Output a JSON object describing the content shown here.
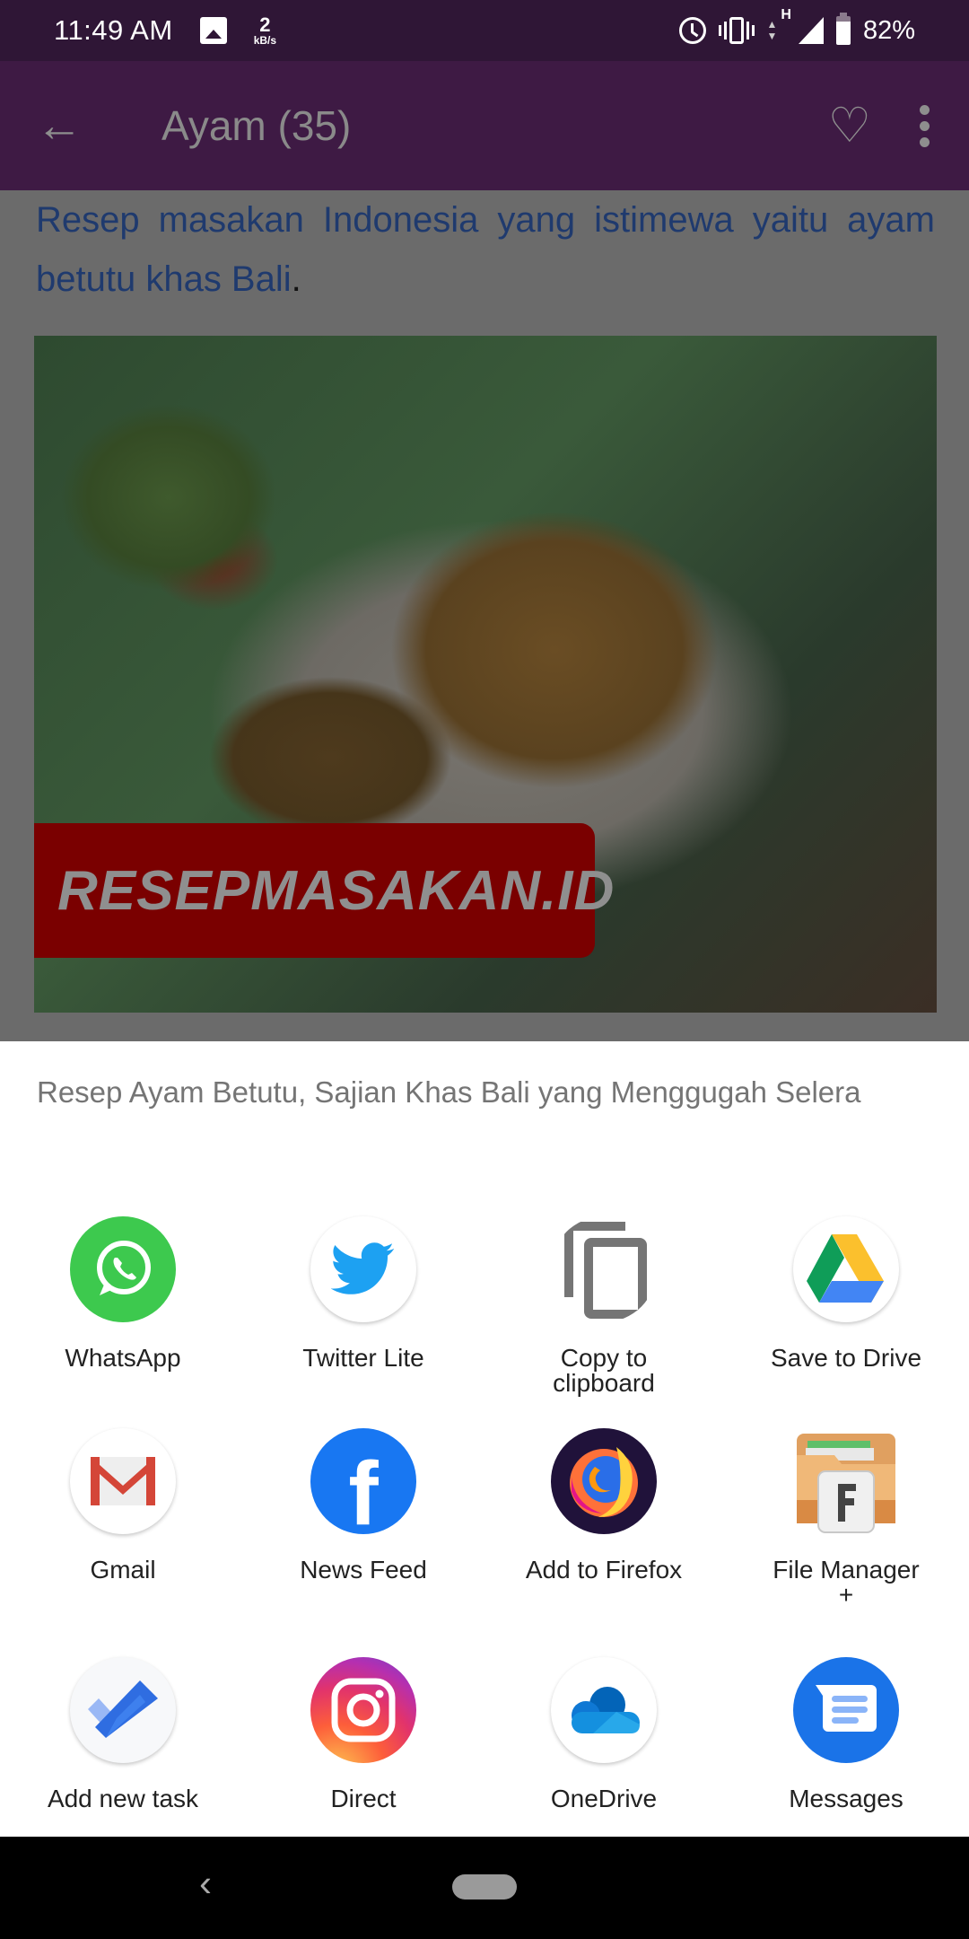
{
  "status_bar": {
    "time": "11:49 AM",
    "net_speed_value": "2",
    "net_speed_unit": "kB/s",
    "network_type": "H",
    "battery": "82%",
    "icons": [
      "gallery-icon",
      "alarm-icon",
      "vibrate-icon",
      "data-arrows-icon",
      "signal-icon",
      "battery-icon"
    ]
  },
  "app_bar": {
    "title": "Ayam (35)",
    "back_icon": "←",
    "favorite_icon": "♡"
  },
  "content": {
    "intro_text": "Resep masakan Indonesia yang istimewa yaitu ayam betutu khas Bali",
    "intro_end": ".",
    "image_watermark": "RESEPMASAKAN.ID"
  },
  "share_sheet": {
    "title": "Resep Ayam Betutu, Sajian Khas Bali yang Menggugah Selera",
    "apps": [
      {
        "label": "WhatsApp",
        "icon": "whatsapp-icon"
      },
      {
        "label": "Twitter Lite",
        "icon": "twitter-icon"
      },
      {
        "label": "Copy to clipboard",
        "icon": "copy-icon"
      },
      {
        "label": "Save to Drive",
        "icon": "google-drive-icon"
      },
      {
        "label": "Gmail",
        "icon": "gmail-icon"
      },
      {
        "label": "News Feed",
        "icon": "facebook-icon"
      },
      {
        "label": "Add to Firefox",
        "icon": "firefox-icon"
      },
      {
        "label": "File Manager +",
        "icon": "file-manager-icon"
      },
      {
        "label": "Add new task",
        "icon": "todo-icon"
      },
      {
        "label": "Direct",
        "icon": "instagram-icon"
      },
      {
        "label": "OneDrive",
        "icon": "onedrive-icon"
      },
      {
        "label": "Messages",
        "icon": "messages-icon"
      }
    ]
  },
  "nav_bar": {
    "back_glyph": "‹"
  },
  "colors": {
    "status_bar": "#2f1636",
    "app_bar_dimmed": "#3e1a44",
    "link_text": "#1f3a6e",
    "sheet_bg": "#ffffff"
  }
}
